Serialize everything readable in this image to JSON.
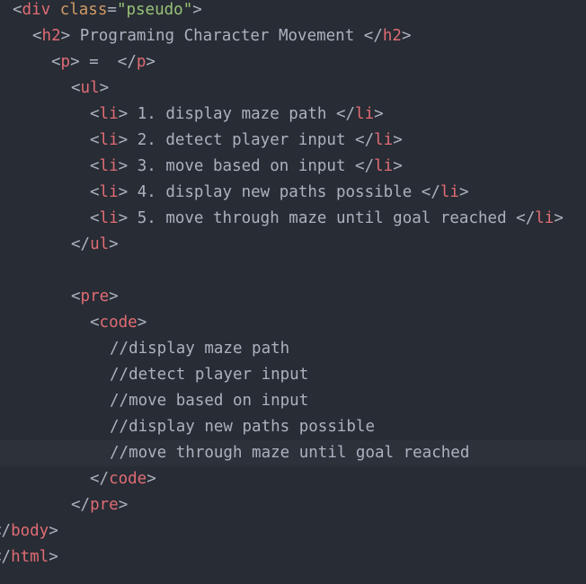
{
  "colors": {
    "background": "#282c34",
    "active_line": "#2c313a",
    "tag": "#e06c75",
    "attribute": "#d19a66",
    "string": "#98c379",
    "text": "#abb2bf"
  },
  "code": {
    "div_tag": "div",
    "div_attr": "class",
    "div_attr_value": "\"pseudo\"",
    "h2_tag": "h2",
    "h2_text": " Programing Character Movement ",
    "p_tag": "p",
    "p_text": " =  ",
    "ul_tag": "ul",
    "li_tag": "li",
    "list_items": [
      " 1. display maze path ",
      " 2. detect player input ",
      " 3. move based on input ",
      " 4. display new paths possible ",
      " 5. move through maze until goal reached "
    ],
    "pre_tag": "pre",
    "code_tag": "code",
    "comments": [
      "//display maze path",
      "//detect player input",
      "//move based on input",
      "//display new paths possible",
      "//move through maze until goal reached"
    ],
    "body_tag": "body",
    "html_tag": "html"
  }
}
